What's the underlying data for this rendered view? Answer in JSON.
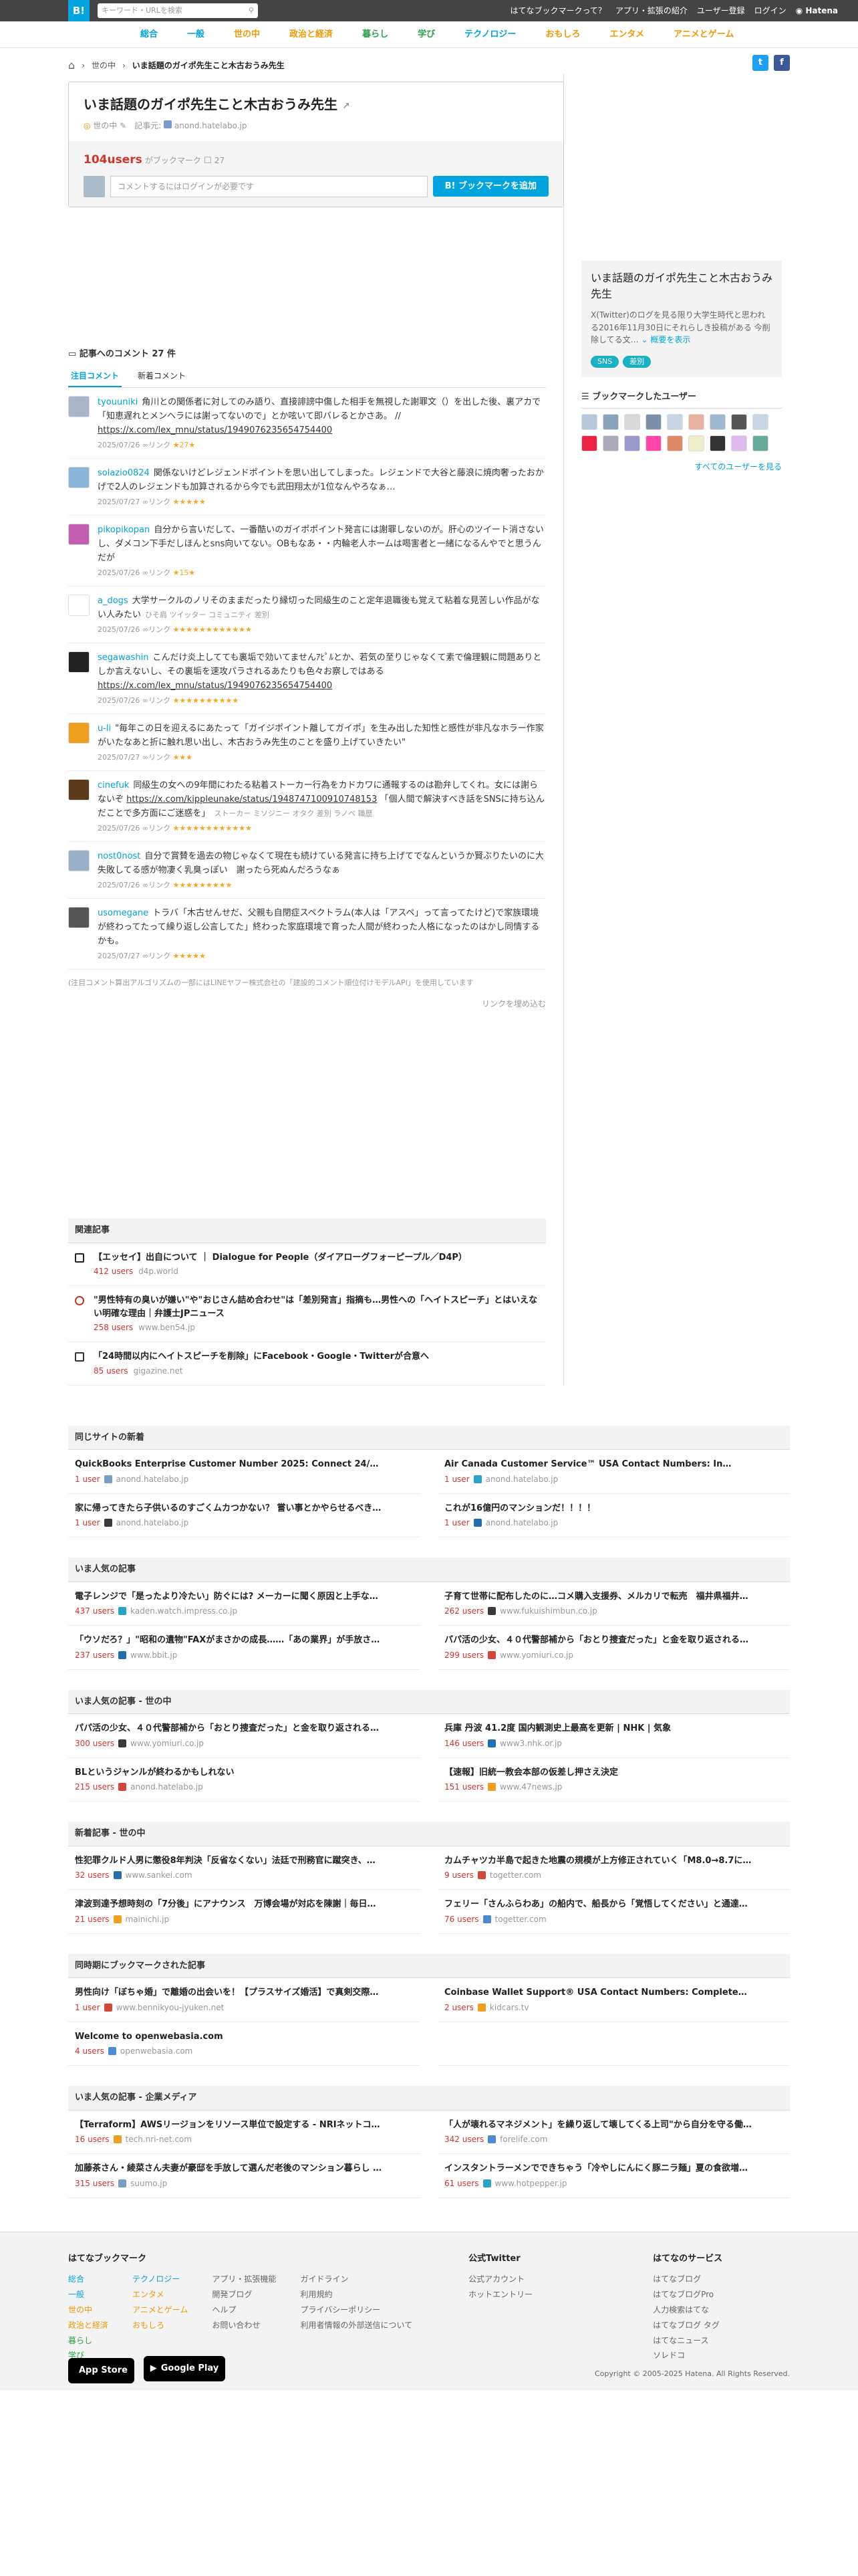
{
  "topbar": {
    "logo": "B!",
    "search_placeholder": "キーワード・URLを検索",
    "links": [
      "はてなブックマークって？",
      "アプリ・拡張の紹介",
      "ユーザー登録",
      "ログイン",
      "Hatena"
    ]
  },
  "catnav": [
    {
      "label": "総合",
      "color": "#00a4de"
    },
    {
      "label": "一般",
      "color": "#00a4de"
    },
    {
      "label": "世の中",
      "color": "#f39800"
    },
    {
      "label": "政治と経済",
      "color": "#f39800"
    },
    {
      "label": "暮らし",
      "color": "#2ca24a"
    },
    {
      "label": "学び",
      "color": "#2ca24a"
    },
    {
      "label": "テクノロジー",
      "color": "#00a4de"
    },
    {
      "label": "おもしろ",
      "color": "#f39800"
    },
    {
      "label": "エンタメ",
      "color": "#f39800"
    },
    {
      "label": "アニメとゲーム",
      "color": "#f39800"
    }
  ],
  "breadcrumb": {
    "home": "home-icon",
    "category": "世の中",
    "current": "いま話題のガイポ先生こと木古おうみ先生"
  },
  "entry": {
    "title": "いま話題のガイポ先生こと木古おうみ先生",
    "category": "世の中",
    "kiji_label": "記事元:",
    "domain": "anond.hatelabo.jp",
    "users": "104users",
    "users_suffix": "がブックマーク",
    "comment_count": "27",
    "comment_placeholder": "コメントするにはログインが必要です",
    "add_button": "ブックマークを追加"
  },
  "comments_section": {
    "heading": "記事へのコメント",
    "count": "27 件",
    "tab_popular": "注目コメント",
    "tab_new": "新着コメント",
    "items": [
      {
        "user": "tyouuniki",
        "text": "角川との関係者に対してのみ語り、直接誹謗中傷した相手を無視した謝罪文（）を出した後、裏アカで「知恵遅れとメンヘラには謝ってないので」とか呟いて即バレるとかさあ。 //",
        "link": "https://x.com/lex_mnu/status/1949076235654754400",
        "date": "2025/07/26",
        "stars": "★27★",
        "av": "#a9b6c8"
      },
      {
        "user": "solazio0824",
        "text": "関係ないけどレジェンドポイントを思い出してしまった。レジェンドで大谷と藤浪に焼肉奢ったおかげで2人のレジェンドも加算されるから今でも武田翔太が1位なんやろなぁ…",
        "link": "",
        "date": "2025/07/27",
        "stars": "★★★★★",
        "av": "#8ab4d8"
      },
      {
        "user": "pikopikopan",
        "text": "自分から言いだして、一番酷いのガイポポイント発言には謝罪しないのが。肝心のツイート消さないし、ダメコン下手だしほんとsns向いてない。OBもなあ・・内輪老人ホームは喝害者と一緒になるんやでと思うんだが",
        "link": "",
        "date": "2025/07/26",
        "stars": "★15★",
        "av": "#c35fb0"
      },
      {
        "user": "a_dogs",
        "text": "大学サークルのノリそのままだったり縁切った同級生のこと定年退職後も覚えて粘着な見苦しい作品がない人みたい",
        "link": "",
        "date": "2025/07/26",
        "stars": "★★★★★★★★★★★★",
        "av": "#ffffff",
        "tags": "ひそ肩 ツイッター コミュニティ 差別"
      },
      {
        "user": "segawashin",
        "text": "こんだけ炎上してても裏垢で効いてませんｱﾋﾟﾙとか、若気の至りじゃなくて素で倫理観に問題ありとしか言えないし、その裏垢を速攻パラされるあたりも色々お察しではある",
        "link": "https://x.com/lex_mnu/status/1949076235654754400",
        "date": "2025/07/26",
        "stars": "★★★★★★★★★★",
        "av": "#222222"
      },
      {
        "user": "u-li",
        "text": "\"毎年この日を迎えるにあたって「ガイジポイント離してガイポ」を生み出した知性と感性が非凡なホラー作家がいたなあと折に触れ思い出し、木古おうみ先生のことを盛り上げていきたい\"",
        "link": "",
        "date": "2025/07/27",
        "stars": "★★★",
        "av": "#f0a020"
      },
      {
        "user": "cinefuk",
        "text": "同級生の女への9年間にわたる粘着ストーカー行為をカドカワに通報するのは勘弁してくれ。女には謝らないぞ",
        "link": "https://x.com/kippleunake/status/1948747100910748153",
        "text2": "「個人間で解決すべき話をSNSに持ち込んだことで多方面にご迷惑を」",
        "date": "2025/07/26",
        "stars": "★★★★★★★★★★★★",
        "av": "#5a3a1a",
        "tags": "ストーカー ミソジニー オタク 差別 ラノベ 職歴"
      },
      {
        "user": "nost0nost",
        "text": "自分で賞賛を過去の物じゃなくて現在も続けている発言に持ち上げてでなんというか賢ぶりたいのに大失敗してる感が物凄く乳臭っぽい　謝ったら死ぬんだろうなぁ",
        "link": "",
        "date": "2025/07/26",
        "stars": "★★★★★★★★★",
        "av": "#9ab0c8"
      },
      {
        "user": "usomegane",
        "text": "トラバ「木古せんせだ、父親も自閉症スペクトラム(本人は「アスペ」って言ってたけど)で家族環境が終わってたって繰り返し公言してた」終わった家庭環境で育った人間が終わった人格になったのはかし同情するかも。",
        "link": "",
        "date": "2025/07/27",
        "stars": "★★★★★",
        "av": "#555555"
      }
    ],
    "note": "(注目コメント算出アルゴリズムの一部にはLINEヤフー株式会社の「建設的コメント順位付けモデルAPI」を使用しています",
    "more": "リンクを埋め込む"
  },
  "related": {
    "heading": "関連記事",
    "items": [
      {
        "title": "【エッセイ】出自について ｜ Dialogue for People（ダイアローグフォーピープル／D4P）",
        "users": "412 users",
        "domain": "d4p.world"
      },
      {
        "title": "\"男性特有の臭いが嫌い\"や\"おじさん詰め合わせ\"は「差別発言」指摘も…男性への「ヘイトスピーチ」とはいえない明確な理由｜弁護士JPニュース",
        "users": "258 users",
        "domain": "www.ben54.jp"
      },
      {
        "title": "「24時間以内にヘイトスピーチを削除」にFacebook・Google・Twitterが合意へ",
        "users": "85 users",
        "domain": "gigazine.net"
      }
    ]
  },
  "side": {
    "title": "いま話題のガイポ先生こと木古おうみ先生",
    "desc": "X(Twitter)のログを見る限り大学生時代と思われる2016年11月30日にそれらしき投稿がある 今削除してる文…",
    "more": "概要を表示",
    "tags": [
      "SNS",
      "差別"
    ],
    "bm_heading": "ブックマークしたユーザー",
    "see_all": "すべてのユーザーを見る"
  },
  "lower": [
    {
      "heading": "同じサイトの新着",
      "items": [
        {
          "t": "QuickBooks Enterprise Customer Number 2025: Connect 24/…",
          "u": "1 user",
          "d": "anond.hatelabo.jp"
        },
        {
          "t": "Air Canada Customer Service™ USA Contact Numbers: In…",
          "u": "1 user",
          "d": "anond.hatelabo.jp"
        },
        {
          "t": "家に帰ってきたら子供いるのすごくムカつかない？ 嘗い事とかやらせるべき…",
          "u": "1 user",
          "d": "anond.hatelabo.jp"
        },
        {
          "t": "これが16億円のマンションだ！！！！",
          "u": "1 user",
          "d": "anond.hatelabo.jp"
        }
      ]
    },
    {
      "heading": "いま人気の記事",
      "items": [
        {
          "t": "電子レンジで「是ったより冷たい」防ぐには? メーカーに聞く原因と上手な…",
          "u": "437 users",
          "d": "kaden.watch.impress.co.jp"
        },
        {
          "t": "子育て世帯に配布したのに…コメ購入支援券、メルカリで転売　福井県福井…",
          "u": "262 users",
          "d": "www.fukuishimbun.co.jp"
        },
        {
          "t": "「ウソだろ？」\"昭和の遺物\"FAXがまさかの成長……「あの業界」が手放さ…",
          "u": "237 users",
          "d": "www.bbit.jp"
        },
        {
          "t": "パパ活の少女、４０代警部補から「おとり捜査だった」と金を取り返される…",
          "u": "299 users",
          "d": "www.yomiuri.co.jp"
        }
      ]
    },
    {
      "heading": "いま人気の記事 - 世の中",
      "items": [
        {
          "t": "パパ活の少女、４０代警部補から「おとり捜査だった」と金を取り返される…",
          "u": "300 users",
          "d": "www.yomiuri.co.jp"
        },
        {
          "t": "兵庫 丹波 41.2度 国内観測史上最高を更新 | NHK | 気象",
          "u": "146 users",
          "d": "www3.nhk.or.jp"
        },
        {
          "t": "BLというジャンルが終わるかもしれない",
          "u": "215 users",
          "d": "anond.hatelabo.jp"
        },
        {
          "t": "【速報】旧統一教会本部の仮差し押さえ決定",
          "u": "151 users",
          "d": "www.47news.jp"
        }
      ]
    },
    {
      "heading": "新着記事 - 世の中",
      "items": [
        {
          "t": "性犯罪クルド人男に懲役8年判決「反省なくない」法廷で刑務官に蹴突き、…",
          "u": "32 users",
          "d": "www.sankei.com"
        },
        {
          "t": "カムチャツカ半島で起きた地震の規模が上方修正されていく「M8.0→8.7に…",
          "u": "9 users",
          "d": "togetter.com"
        },
        {
          "t": "津波到達予想時刻の「7分後」にアナウンス　万博会場が対応を陳謝｜毎日…",
          "u": "21 users",
          "d": "mainichi.jp"
        },
        {
          "t": "フェリー「さんふらわあ」の船内で、船長から「覚悟してください」と通達…",
          "u": "76 users",
          "d": "togetter.com"
        }
      ]
    },
    {
      "heading": "同時期にブックマークされた記事",
      "items": [
        {
          "t": "男性向け「ぼちゃ婚」で離婚の出会いを！【プラスサイズ婚活】で真剣交際…",
          "u": "1 user",
          "d": "www.bennikyou-jyuken.net"
        },
        {
          "t": "Coinbase Wallet Support® USA Contact Numbers: Complete…",
          "u": "2 users",
          "d": "kidcars.tv"
        },
        {
          "t": "Welcome to openwebasia.com",
          "u": "4 users",
          "d": "openwebasia.com"
        },
        {
          "t": "",
          "u": "",
          "d": ""
        }
      ]
    },
    {
      "heading": "いま人気の記事 - 企業メディア",
      "items": [
        {
          "t": "【Terraform】AWSリージョンをリソース単位で設定する - NRIネットコ…",
          "u": "16 users",
          "d": "tech.nri-net.com"
        },
        {
          "t": "「人が壊れるマネジメント」を繰り返して壊してくる上司\"から自分を守る働…",
          "u": "342 users",
          "d": "forelife.com"
        },
        {
          "t": "加藤茶さん・綾菜さん夫妻が豪邸を手放して選んだ老後のマンション暮らし …",
          "u": "315 users",
          "d": "suumo.jp"
        },
        {
          "t": "インスタントラーメンでできちゃう「冷やしにんにく豚ニラ麺」夏の食欲増…",
          "u": "61 users",
          "d": "www.hotpepper.jp"
        }
      ]
    }
  ],
  "footer": {
    "col1_title": "はてなブックマーク",
    "col1a": [
      "総合",
      "一般",
      "世の中",
      "政治と経済",
      "暮らし",
      "学び"
    ],
    "col1b": [
      "テクノロジー",
      "エンタメ",
      "アニメとゲーム",
      "おもしろ"
    ],
    "col1c": [
      "アプリ・拡張機能",
      "開発ブログ",
      "ヘルプ",
      "お問い合わせ"
    ],
    "col1d": [
      "ガイドライン",
      "利用規約",
      "プライバシーポリシー",
      "利用者情報の外部送信について"
    ],
    "col2_title": "公式Twitter",
    "col2": [
      "公式アカウント",
      "ホットエントリー"
    ],
    "col3_title": "はてなのサービス",
    "col3": [
      "はてなブログ",
      "はてなブログPro",
      "人力検索はてな",
      "はてなブログ タグ",
      "はてなニュース",
      "ソレドコ"
    ],
    "appstore": "App Store",
    "googleplay": "Google Play",
    "copyright": "Copyright © 2005-2025 Hatena. All Rights Reserved."
  }
}
